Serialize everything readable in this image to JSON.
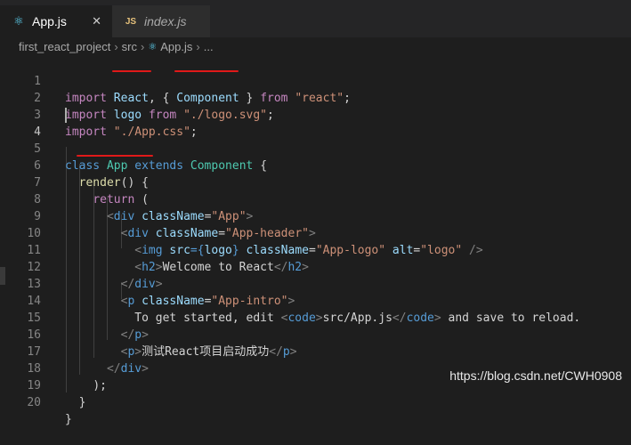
{
  "tabs": [
    {
      "icon": "react-icon",
      "label": "App.js",
      "close": "✕"
    },
    {
      "icon": "js-icon",
      "label": "index.js",
      "close": ""
    }
  ],
  "js_badge": "JS",
  "breadcrumb": {
    "project": "first_react_project",
    "folder": "src",
    "file": "App.js",
    "more": "..."
  },
  "line_numbers": [
    "1",
    "2",
    "3",
    "4",
    "5",
    "6",
    "7",
    "8",
    "9",
    "10",
    "11",
    "12",
    "13",
    "14",
    "15",
    "16",
    "17",
    "18",
    "19",
    "20"
  ],
  "code": {
    "l1": [
      "import",
      "React",
      ",",
      "{",
      "Component",
      "}",
      "from",
      "\"react\"",
      ";"
    ],
    "l2": [
      "import",
      "logo",
      "from",
      "\"./logo.svg\"",
      ";"
    ],
    "l3": [
      "import",
      "\"./App.css\"",
      ";"
    ],
    "l5": [
      "class",
      "App",
      "extends",
      "Component",
      "{"
    ],
    "l6": [
      "render",
      "()",
      "{"
    ],
    "l7": [
      "return",
      "("
    ],
    "l8": [
      "<",
      "div",
      "className",
      "=",
      "\"App\"",
      ">"
    ],
    "l9": [
      "<",
      "div",
      "className",
      "=",
      "\"App-header\"",
      ">"
    ],
    "l10": [
      "<",
      "img",
      "src",
      "={",
      "logo",
      "}",
      "className",
      "=",
      "\"App-logo\"",
      "alt",
      "=",
      "\"logo\"",
      "/>"
    ],
    "l11": [
      "<",
      "h2",
      ">",
      "Welcome to React",
      "</",
      "h2",
      ">"
    ],
    "l12": [
      "</",
      "div",
      ">"
    ],
    "l13": [
      "<",
      "p",
      "className",
      "=",
      "\"App-intro\"",
      ">"
    ],
    "l14": [
      "To get started, edit ",
      "<",
      "code",
      ">",
      "src/App.js",
      "</",
      "code",
      ">",
      " and save to reload."
    ],
    "l15": [
      "</",
      "p",
      ">"
    ],
    "l16": [
      "<",
      "p",
      ">",
      "测试React项目启动成功",
      "</",
      "p",
      ">"
    ],
    "l17": [
      "</",
      "div",
      ">"
    ],
    "l18": [
      ");"
    ],
    "l19": [
      "}"
    ],
    "l20": [
      "}"
    ]
  },
  "watermark": "https://blog.csdn.net/CWH0908",
  "colors": {
    "background": "#1e1e1e",
    "keyword": "#569cd6",
    "control": "#c586c0",
    "string": "#ce9178",
    "type": "#4ec9b0",
    "attribute": "#9cdcfe",
    "function": "#dcdcaa",
    "underline_annotation": "#e01919"
  }
}
